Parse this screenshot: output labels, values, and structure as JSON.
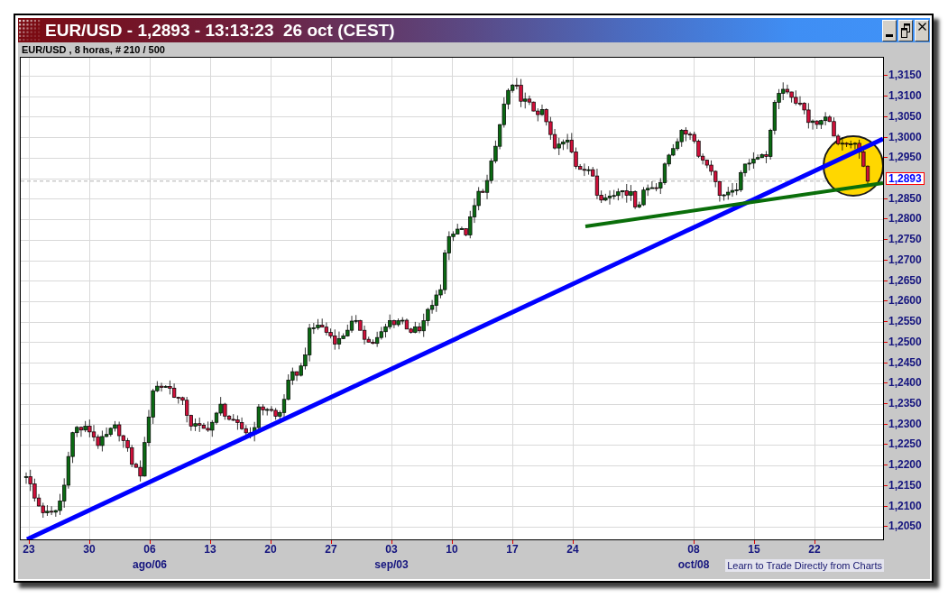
{
  "window": {
    "title": "EUR/USD - 1,2893 - 13:13:23  26 oct (CEST)"
  },
  "chart": {
    "subtitle": "EUR/USD , 8 horas, # 210 / 500",
    "price_axis": [
      {
        "label": "1,3150",
        "kind": "tick"
      },
      {
        "label": "1,3100",
        "kind": "tick"
      },
      {
        "label": "1,3050",
        "kind": "tick"
      },
      {
        "label": "1,3000",
        "kind": "tick"
      },
      {
        "label": "1,2950",
        "kind": "tick"
      },
      {
        "label": "1,2893",
        "kind": "current"
      },
      {
        "label": "1,2850",
        "kind": "tick"
      },
      {
        "label": "1,2800",
        "kind": "tick"
      },
      {
        "label": "1,2750",
        "kind": "tick"
      },
      {
        "label": "1,2700",
        "kind": "tick"
      },
      {
        "label": "1,2650",
        "kind": "tick"
      },
      {
        "label": "1,2600",
        "kind": "tick"
      },
      {
        "label": "1,2550",
        "kind": "tick"
      },
      {
        "label": "1,2500",
        "kind": "tick"
      },
      {
        "label": "1,2450",
        "kind": "tick"
      },
      {
        "label": "1,2400",
        "kind": "tick"
      },
      {
        "label": "1,2350",
        "kind": "tick"
      },
      {
        "label": "1,2300",
        "kind": "tick"
      },
      {
        "label": "1,2250",
        "kind": "tick"
      },
      {
        "label": "1,2200",
        "kind": "tick"
      },
      {
        "label": "1,2150",
        "kind": "tick"
      },
      {
        "label": "1,2100",
        "kind": "tick"
      },
      {
        "label": "1,2050",
        "kind": "tick"
      }
    ],
    "date_axis": [
      {
        "day": "23"
      },
      {
        "day": "30"
      },
      {
        "day": "06",
        "month": "ago/06"
      },
      {
        "day": "13"
      },
      {
        "day": "20"
      },
      {
        "day": "27"
      },
      {
        "day": "03",
        "month": "sep/03"
      },
      {
        "day": "10"
      },
      {
        "day": "17"
      },
      {
        "day": "24"
      },
      {
        "day": "08",
        "month": "oct/08"
      },
      {
        "day": "15"
      },
      {
        "day": "22"
      }
    ],
    "link": "Learn to Trade Directly from Charts"
  }
}
